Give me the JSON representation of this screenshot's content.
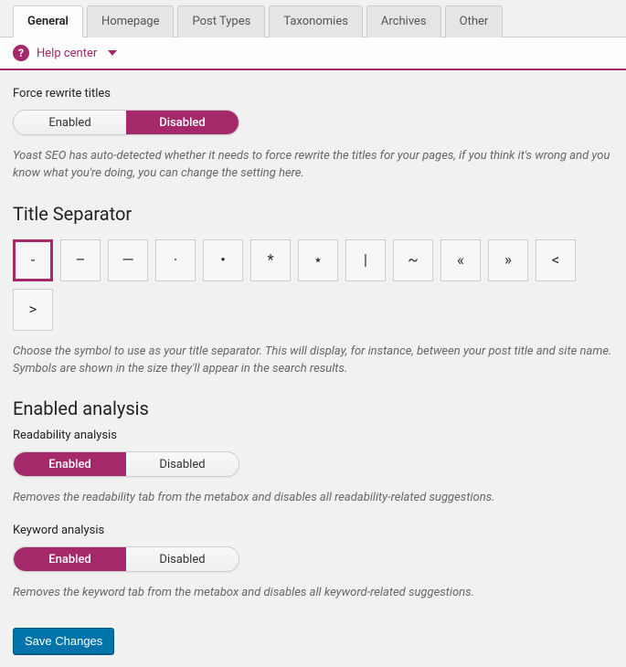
{
  "tabs": {
    "general": "General",
    "homepage": "Homepage",
    "post_types": "Post Types",
    "taxonomies": "Taxonomies",
    "archives": "Archives",
    "other": "Other"
  },
  "help": {
    "label": "Help center"
  },
  "force_rewrite": {
    "label": "Force rewrite titles",
    "enabled": "Enabled",
    "disabled": "Disabled",
    "hint": "Yoast SEO has auto-detected whether it needs to force rewrite the titles for your pages, if you think it's wrong and you know what you're doing, you can change the setting here."
  },
  "title_separator": {
    "heading": "Title Separator",
    "symbols": [
      "-",
      "–",
      "—",
      "·",
      "•",
      "*",
      "⋆",
      "|",
      "~",
      "«",
      "»",
      "<",
      ">"
    ],
    "hint": "Choose the symbol to use as your title separator. This will display, for instance, between your post title and site name. Symbols are shown in the size they'll appear in the search results."
  },
  "enabled_analysis": {
    "heading": "Enabled analysis"
  },
  "readability": {
    "label": "Readability analysis",
    "enabled": "Enabled",
    "disabled": "Disabled",
    "hint": "Removes the readability tab from the metabox and disables all readability-related suggestions."
  },
  "keyword": {
    "label": "Keyword analysis",
    "enabled": "Enabled",
    "disabled": "Disabled",
    "hint": "Removes the keyword tab from the metabox and disables all keyword-related suggestions."
  },
  "save": {
    "label": "Save Changes"
  }
}
